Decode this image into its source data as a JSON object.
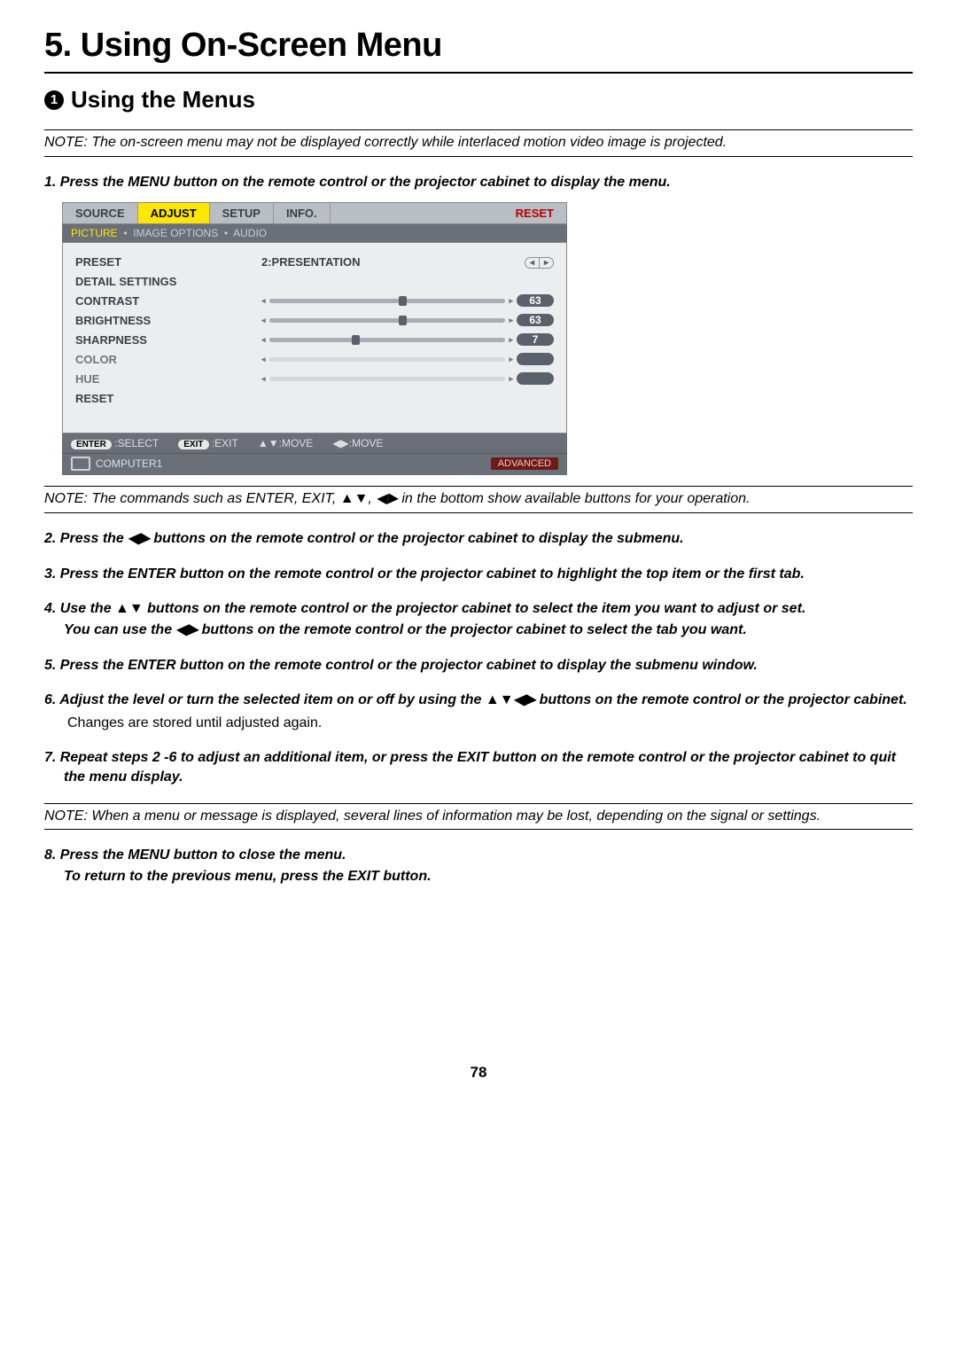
{
  "chapter_title": "5. Using On-Screen Menu",
  "section_number": "1",
  "section_title": "Using the Menus",
  "note1": "NOTE: The on-screen menu may not be displayed correctly while interlaced motion video image is projected.",
  "step1": "1.  Press the MENU button on the remote control or the projector cabinet to display the menu.",
  "note2": "NOTE: The commands such as ENTER, EXIT, ▲▼, ◀▶  in the bottom show available buttons for your operation.",
  "step2": "2.  Press the ◀▶ buttons on the remote control or the projector cabinet to display the submenu.",
  "step3": "3.  Press the ENTER button on the remote control or the projector cabinet to highlight the top item or the first tab.",
  "step4": "4.  Use the ▲▼ buttons on the remote control or the projector cabinet to select the item you want to adjust or set.",
  "step4b": "You can use the ◀▶ buttons on the remote control or the projector cabinet to select the tab you want.",
  "step5": "5.  Press the ENTER button on the remote control or the projector cabinet to display the submenu window.",
  "step6": "6.  Adjust the level or turn the selected item on or off by using the ▲▼◀▶ buttons on the remote control or the projector cabinet.",
  "step6b": "Changes are stored until adjusted again.",
  "step7": "7.  Repeat steps 2 -6 to adjust an additional item, or press the EXIT button on the remote control or the projector cabinet to quit the menu display.",
  "note3": "NOTE: When a menu or message is displayed, several lines of information may be lost, depending on the signal or settings.",
  "step8": "8.  Press the MENU button to close the menu.",
  "step8b": "To return to the previous menu, press the EXIT button.",
  "page_number": "78",
  "osd": {
    "tabs": {
      "source": "SOURCE",
      "adjust": "ADJUST",
      "setup": "SETUP",
      "info": "INFO.",
      "reset": "RESET"
    },
    "subtabs": {
      "picture": "PICTURE",
      "image_options": "IMAGE OPTIONS",
      "audio": "AUDIO"
    },
    "rows": {
      "preset_label": "PRESET",
      "preset_value": "2:PRESENTATION",
      "detail_label": "DETAIL SETTINGS",
      "contrast_label": "CONTRAST",
      "contrast_value": "63",
      "brightness_label": "BRIGHTNESS",
      "brightness_value": "63",
      "sharpness_label": "SHARPNESS",
      "sharpness_value": "7",
      "color_label": "COLOR",
      "hue_label": "HUE",
      "reset_label": "RESET"
    },
    "footer": {
      "enter": "ENTER",
      "select": ":SELECT",
      "exit": "EXIT",
      "exit_lbl": ":EXIT",
      "move_v": ":MOVE",
      "move_h": ":MOVE",
      "source": "COMPUTER1",
      "advanced": "ADVANCED"
    }
  }
}
